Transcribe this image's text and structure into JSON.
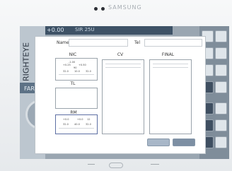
{
  "device": {
    "brand": "SAMSUNG"
  },
  "eye_panel": {
    "label": "RIGHTEYE",
    "mode": "FAR",
    "top_value_1": "+0.00",
    "top_value_2": "SIR 25U"
  },
  "dialog": {
    "name_label": "Name",
    "tel_label": "Tel",
    "sections": {
      "nc": "NIC",
      "tl": "TL",
      "rm": "RM",
      "cv": "CV",
      "final": "FINAL"
    },
    "nc_values": [
      "-1.00",
      "+0.25",
      "+0.50",
      "90",
      "32.0",
      "10.0",
      "32.0"
    ],
    "rm_values": [
      "+0.0",
      "+0.0",
      "12",
      "32.0",
      "40.0",
      "32.0"
    ]
  }
}
